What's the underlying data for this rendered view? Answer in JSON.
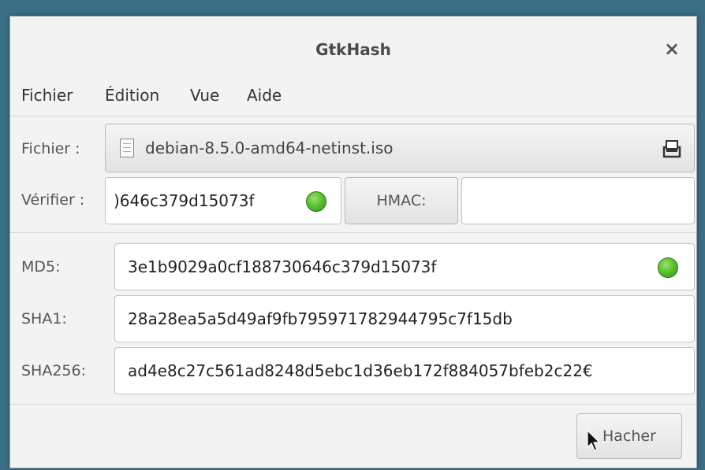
{
  "window": {
    "title": "GtkHash"
  },
  "menu": [
    "Fichier",
    "Édition",
    "Vue",
    "Aide"
  ],
  "file": {
    "label": "Fichier :",
    "value": "debian-8.5.0-amd64-netinst.iso"
  },
  "verify": {
    "label": "Vérifier :",
    "value": ")646c379d15073f",
    "hmac_label": "HMAC:",
    "hmac_value": ""
  },
  "hashes": [
    {
      "label": "MD5:",
      "value": "3e1b9029a0cf188730646c379d15073f"
    },
    {
      "label": "SHA1:",
      "value": "28a28ea5a5d49af9fb795971782944795c7f15db"
    },
    {
      "label": "SHA256:",
      "value": "ad4e8c27c561ad8248d5ebc1d36eb172f884057bfeb2c22€"
    }
  ],
  "actions": {
    "hash_label": "Hacher"
  },
  "colors": {
    "match_led": "#5cc033",
    "desktop": "#3a6f86"
  },
  "icons": {
    "file": "file-icon",
    "open": "open-file-icon",
    "close": "close-icon",
    "cursor": "mouse-cursor-icon"
  }
}
